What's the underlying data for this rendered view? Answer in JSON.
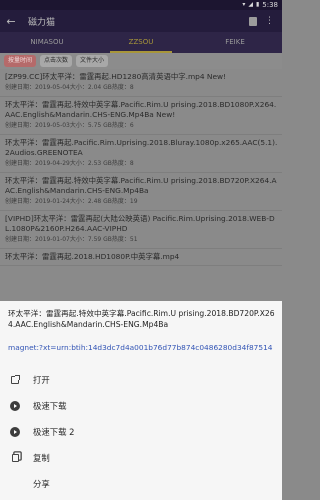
{
  "status_bar": {
    "time": "5:38",
    "icons": [
      "wifi-icon",
      "signal-icon",
      "battery-icon"
    ]
  },
  "app_bar": {
    "title": "磁力猫"
  },
  "tabs": [
    {
      "label": "NIMASOU",
      "active": false
    },
    {
      "label": "ZZSOU",
      "active": true
    },
    {
      "label": "FEIKE",
      "active": false
    }
  ],
  "filters": [
    {
      "label": "按量时间",
      "active": true
    },
    {
      "label": "点击次数",
      "active": false
    },
    {
      "label": "文件大小",
      "active": false
    }
  ],
  "results": [
    {
      "title": "[ZP99.CC]环太平洋：雷霆再起.HD1280高清英语中字.mp4 New!",
      "meta": "创建日期：2019-05-04大小：2.04 GB热度：8"
    },
    {
      "title": "环太平洋：雷霆再起.特效中英字幕.Pacific.Rim.U prising.2018.BD1080P.X264.AAC.English&Mandarin.CHS-ENG.Mp4Ba New!",
      "meta": "创建日期：2019-05-03大小：5.75 GB热度：6"
    },
    {
      "title": "环太平洋：雷霆再起.Pacific.Rim.Uprising.2018.Bluray.1080p.x265.AAC(5.1).2Audios.GREENOTEA",
      "meta": "创建日期：2019-04-29大小：2.53 GB热度：8"
    },
    {
      "title": "环太平洋：雷霆再起.特效中英字幕.Pacific.Rim.U prising.2018.BD720P.X264.AAC.English&Mandarin.CHS-ENG.Mp4Ba",
      "meta": "创建日期：2019-01-24大小：2.48 GB热度：19"
    },
    {
      "title": "[VIPHD]环太平洋：雷霆再起(大陆公映英语) Pacific.Rim.Uprising.2018.WEB-DL.1080P&2160P.H264.AAC-VIPHD",
      "meta": "创建日期：2019-01-07大小：7.59 GB热度：51"
    },
    {
      "title": "环太平洋：雷霆再起.2018.HD1080P.中英字幕.mp4",
      "meta": ""
    }
  ],
  "sheet": {
    "title": "环太平洋：雷霆再起.特效中英字幕.Pacific.Rim.U prising.2018.BD720P.X264.AAC.English&Mandarin.CHS-ENG.Mp4Ba",
    "magnet": "magnet:?xt=urn:btih:14d3dc7d4a001b76d77b874c0486280d34f87514",
    "menu": [
      {
        "label": "打开",
        "icon": "open-external-icon",
        "kind": "open"
      },
      {
        "label": "极速下载",
        "icon": "play-circle-icon",
        "kind": "play"
      },
      {
        "label": "极速下载 2",
        "icon": "play-circle-icon",
        "kind": "play"
      },
      {
        "label": "复制",
        "icon": "copy-icon",
        "kind": "copy"
      },
      {
        "label": "分享",
        "icon": "",
        "kind": "none"
      }
    ]
  },
  "colors": {
    "sheet_background": "#f6f6f6",
    "magnet_link": "#3355b5",
    "active_tab": "#a8963a",
    "active_chip": "#b56a6a"
  }
}
